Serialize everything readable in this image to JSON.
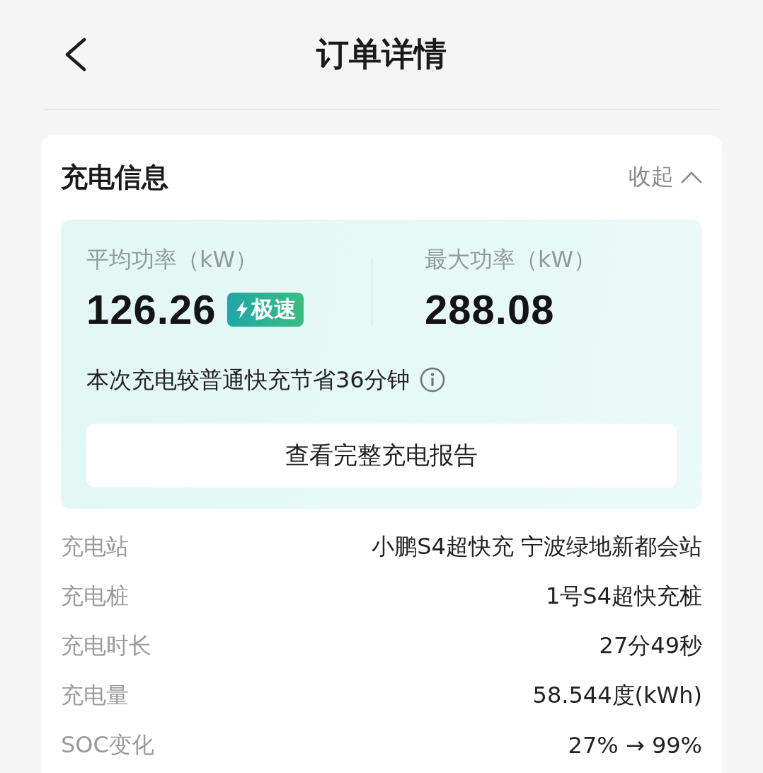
{
  "header": {
    "title": "订单详情"
  },
  "card": {
    "title": "充电信息",
    "toggle": {
      "label": "收起",
      "expanded": true
    }
  },
  "summary": {
    "metrics": [
      {
        "label": "平均功率（kW）",
        "value": "126.26",
        "badge": "极速"
      },
      {
        "label": "最大功率（kW）",
        "value": "288.08"
      }
    ],
    "note": "本次充电较普通快充节省36分钟",
    "button": "查看完整充电报告"
  },
  "details": [
    {
      "label": "充电站",
      "value": "小鹏S4超快充 宁波绿地新都会站"
    },
    {
      "label": "充电桩",
      "value": "1号S4超快充桩"
    },
    {
      "label": "充电时长",
      "value": "27分49秒"
    },
    {
      "label": "充电量",
      "value": "58.544度(kWh)"
    },
    {
      "label": "SOC变化",
      "value": "27% → 99%"
    }
  ]
}
